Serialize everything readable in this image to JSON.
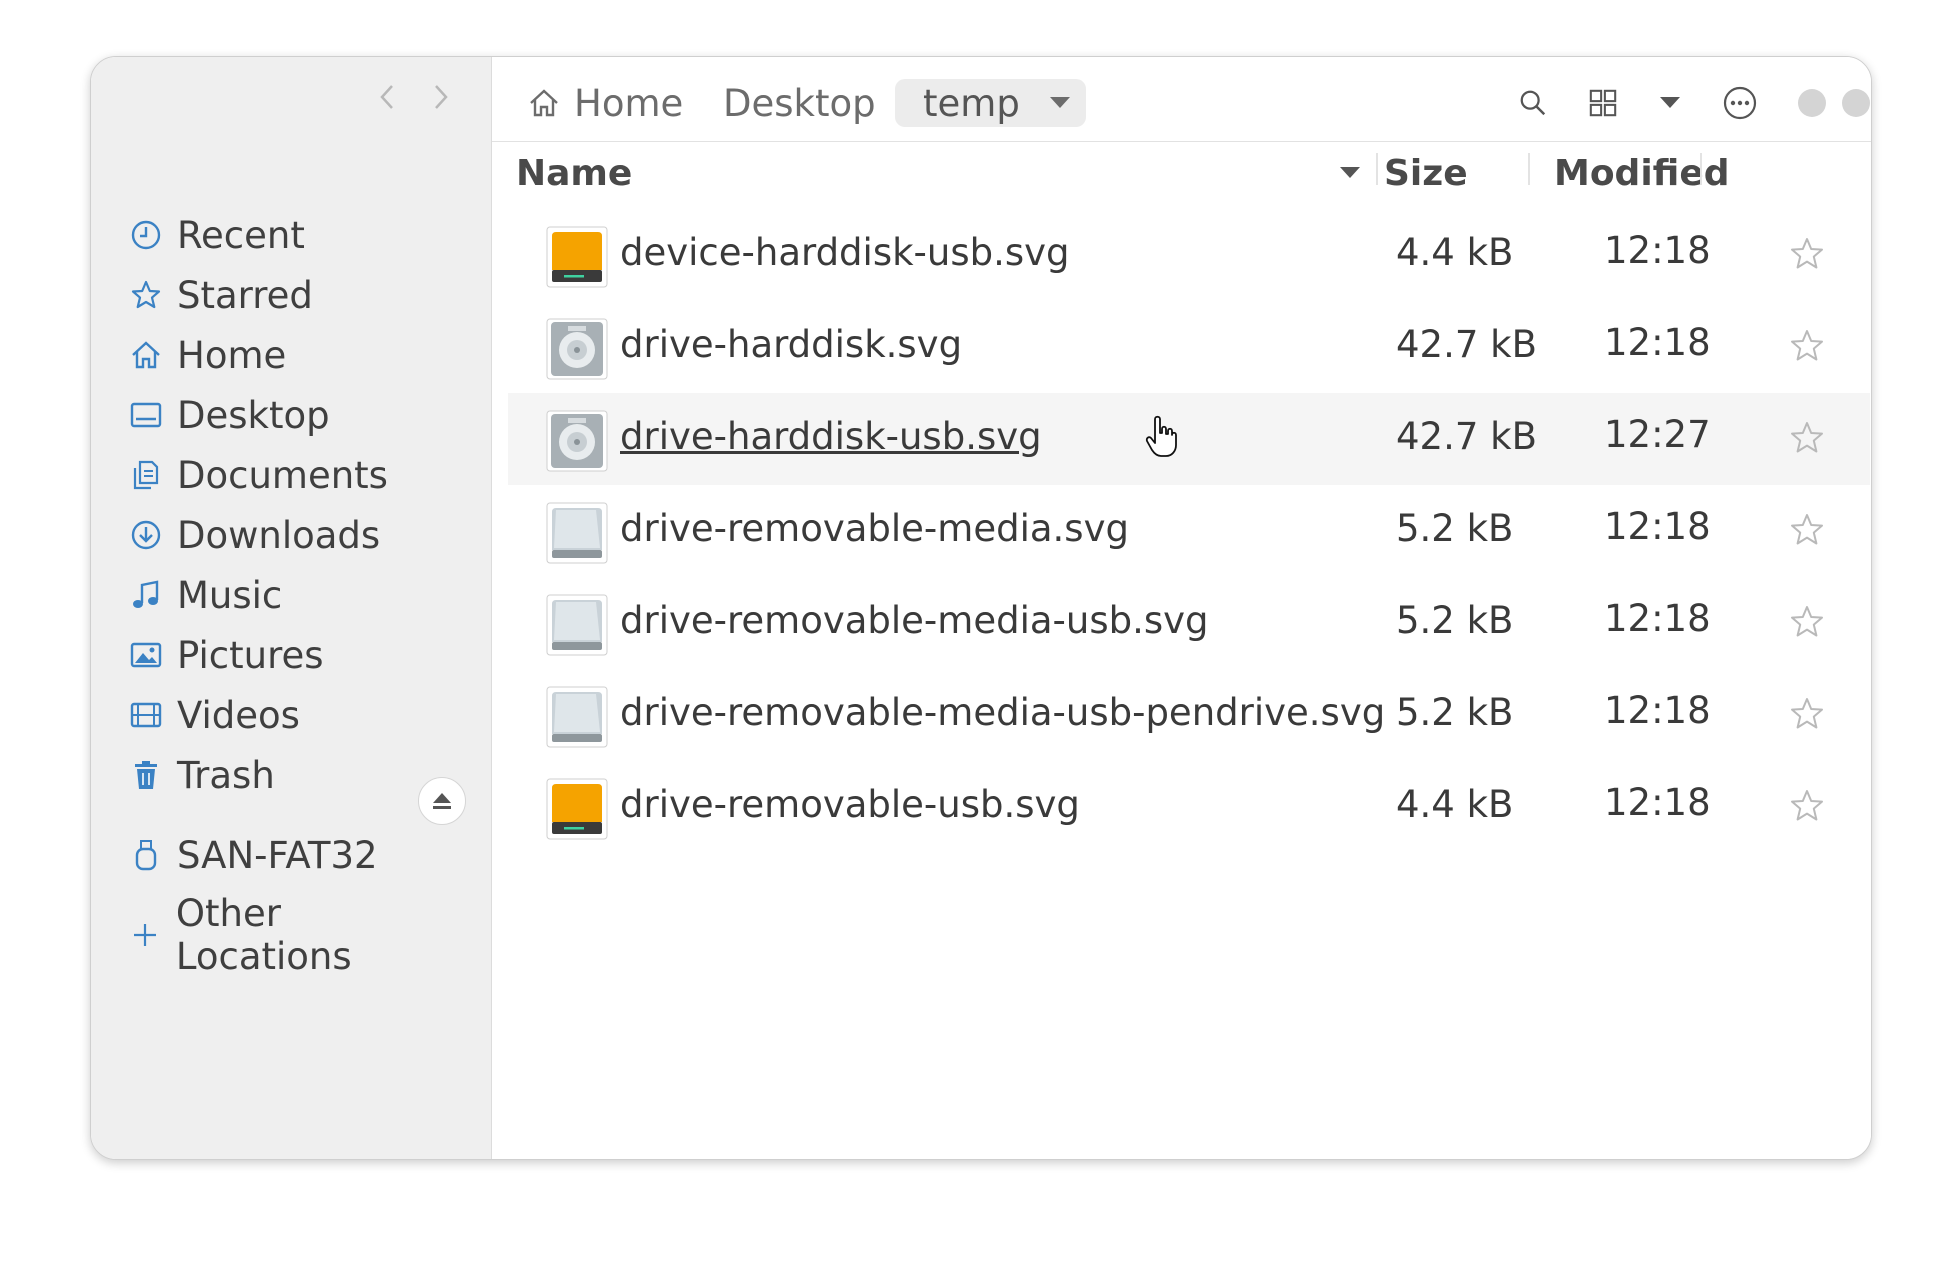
{
  "sidebar": {
    "items": [
      {
        "label": "Recent",
        "icon": "clock-icon"
      },
      {
        "label": "Starred",
        "icon": "star-icon"
      },
      {
        "label": "Home",
        "icon": "home-icon"
      },
      {
        "label": "Desktop",
        "icon": "desktop-icon"
      },
      {
        "label": "Documents",
        "icon": "documents-icon"
      },
      {
        "label": "Downloads",
        "icon": "download-icon"
      },
      {
        "label": "Music",
        "icon": "music-icon"
      },
      {
        "label": "Pictures",
        "icon": "pictures-icon"
      },
      {
        "label": "Videos",
        "icon": "video-icon"
      },
      {
        "label": "Trash",
        "icon": "trash-icon"
      }
    ],
    "device": {
      "label": "SAN-FAT32",
      "icon": "usb-drive-icon"
    },
    "other_locations": "Other Locations"
  },
  "breadcrumb": {
    "home": "Home",
    "desktop": "Desktop",
    "current": "temp"
  },
  "columns": {
    "name": "Name",
    "size": "Size",
    "modified": "Modified"
  },
  "files": [
    {
      "name": "device-harddisk-usb.svg",
      "size": "4.4 kB",
      "modified": "12:18",
      "icon": "orange-drive-icon"
    },
    {
      "name": "drive-harddisk.svg",
      "size": "42.7 kB",
      "modified": "12:18",
      "icon": "harddisk-icon"
    },
    {
      "name": "drive-harddisk-usb.svg",
      "size": "42.7 kB",
      "modified": "12:27",
      "icon": "harddisk-icon",
      "hovered": true
    },
    {
      "name": "drive-removable-media.svg",
      "size": "5.2 kB",
      "modified": "12:18",
      "icon": "removable-drive-icon"
    },
    {
      "name": "drive-removable-media-usb.svg",
      "size": "5.2 kB",
      "modified": "12:18",
      "icon": "removable-drive-icon"
    },
    {
      "name": "drive-removable-media-usb-pendrive.svg",
      "size": "5.2 kB",
      "modified": "12:18",
      "icon": "removable-drive-icon"
    },
    {
      "name": "drive-removable-usb.svg",
      "size": "4.4 kB",
      "modified": "12:18",
      "icon": "orange-drive-icon"
    }
  ],
  "colors": {
    "accent": "#3b82c4",
    "sidebar_bg": "#efefef",
    "orange_drive": "#f5a300",
    "hover_row": "#f5f5f5"
  }
}
